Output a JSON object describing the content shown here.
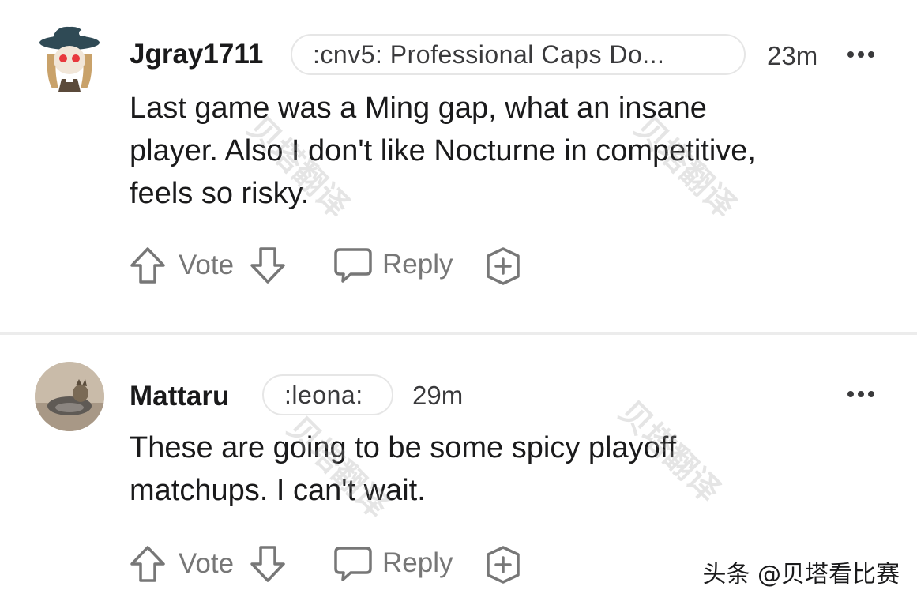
{
  "comments": [
    {
      "username": "Jgray1711",
      "flair": ":cnv5: Professional Caps Do...",
      "time": "23m",
      "body": "Last game was a Ming gap, what an insane\nplayer. Also I don't like Nocturne in competitive,\nfeels so risky.",
      "vote_label": "Vote",
      "reply_label": "Reply"
    },
    {
      "username": "Mattaru",
      "flair": ":leona:",
      "time": "29m",
      "body": "These are going to be some spicy playoff\nmatchups. I can't wait.",
      "vote_label": "Vote",
      "reply_label": "Reply"
    }
  ],
  "watermark_text": "贝塔翻译",
  "source_text": "头条 @贝塔看比赛",
  "icons": {
    "upvote": "arrow-up-outline-icon",
    "downvote": "arrow-down-outline-icon",
    "reply": "speech-bubble-icon",
    "award": "award-plus-icon",
    "more": "more-dots-icon"
  },
  "colors": {
    "text": "#1a1a1b",
    "muted": "#777777",
    "border": "#e6e6e6",
    "divider": "#ececec"
  }
}
